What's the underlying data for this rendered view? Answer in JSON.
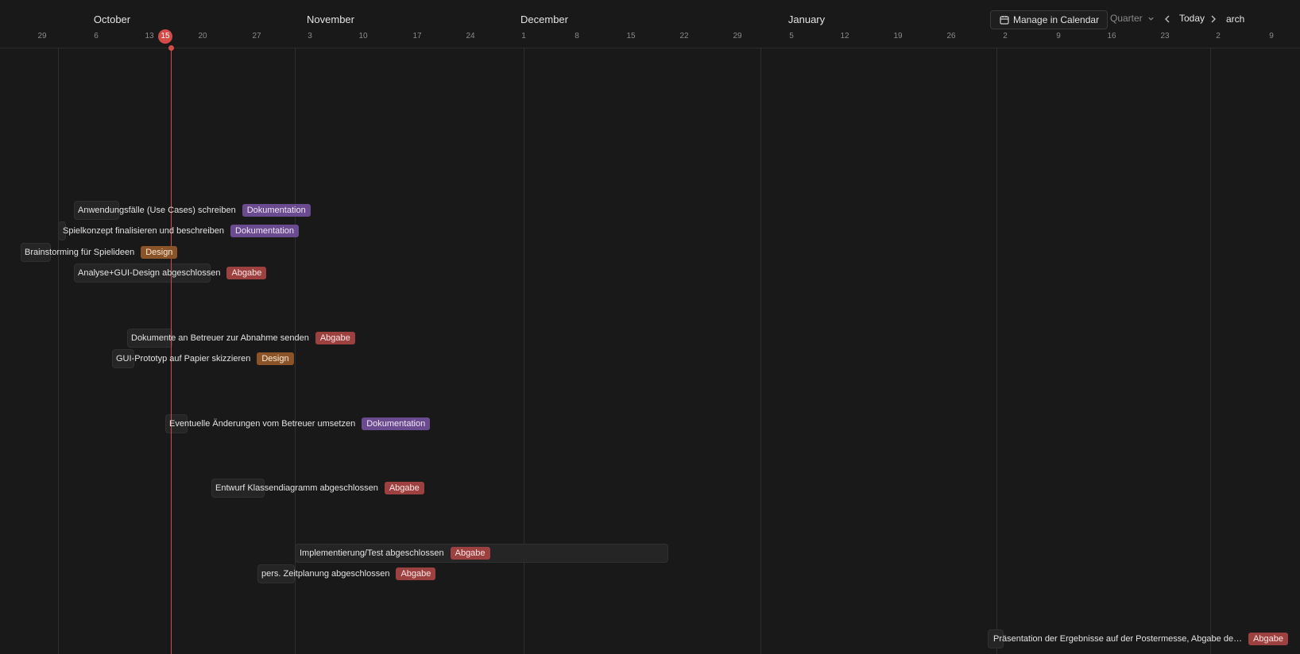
{
  "header": {
    "months": [
      "October",
      "November",
      "December",
      "January"
    ],
    "days": [
      "29",
      "6",
      "13",
      "20",
      "27",
      "3",
      "10",
      "17",
      "24",
      "1",
      "8",
      "15",
      "22",
      "29",
      "5",
      "12",
      "19",
      "26",
      "2",
      "9",
      "16",
      "23",
      "2",
      "9"
    ],
    "today_day": "15",
    "partial_month_label": "arch"
  },
  "controls": {
    "manage_label": "Manage in Calendar",
    "view_label": "Quarter",
    "today_label": "Today"
  },
  "tags": {
    "dokumentation": "Dokumentation",
    "design": "Design",
    "abgabe": "Abgabe"
  },
  "colors": {
    "today_accent": "#d44c47",
    "tag_dokumentation": "#6b4b8f",
    "tag_design": "#8a5428",
    "tag_abgabe": "#9c4040"
  },
  "tasks": [
    {
      "title": "Anwendungsfälle (Use Cases) schreiben",
      "tag": "Dokumentation"
    },
    {
      "title": "Spielkonzept finalisieren und beschreiben",
      "tag": "Dokumentation"
    },
    {
      "title": "Brainstorming für Spielideen",
      "tag": "Design"
    },
    {
      "title": "Analyse+GUI-Design abgeschlossen",
      "tag": "Abgabe"
    },
    {
      "title": "Dokumente an Betreuer zur Abnahme senden",
      "tag": "Abgabe"
    },
    {
      "title": "GUI-Prototyp auf Papier skizzieren",
      "tag": "Design"
    },
    {
      "title": "Eventuelle Änderungen vom Betreuer umsetzen",
      "tag": "Dokumentation"
    },
    {
      "title": "Entwurf Klassendiagramm abgeschlossen",
      "tag": "Abgabe"
    },
    {
      "title": "Implementierung/Test abgeschlossen",
      "tag": "Abgabe"
    },
    {
      "title": "pers. Zeitplanung abgeschlossen",
      "tag": "Abgabe"
    },
    {
      "title": "Präsentation der Ergebnisse auf der Postermesse, Abgabe de…",
      "tag": "Abgabe"
    }
  ]
}
